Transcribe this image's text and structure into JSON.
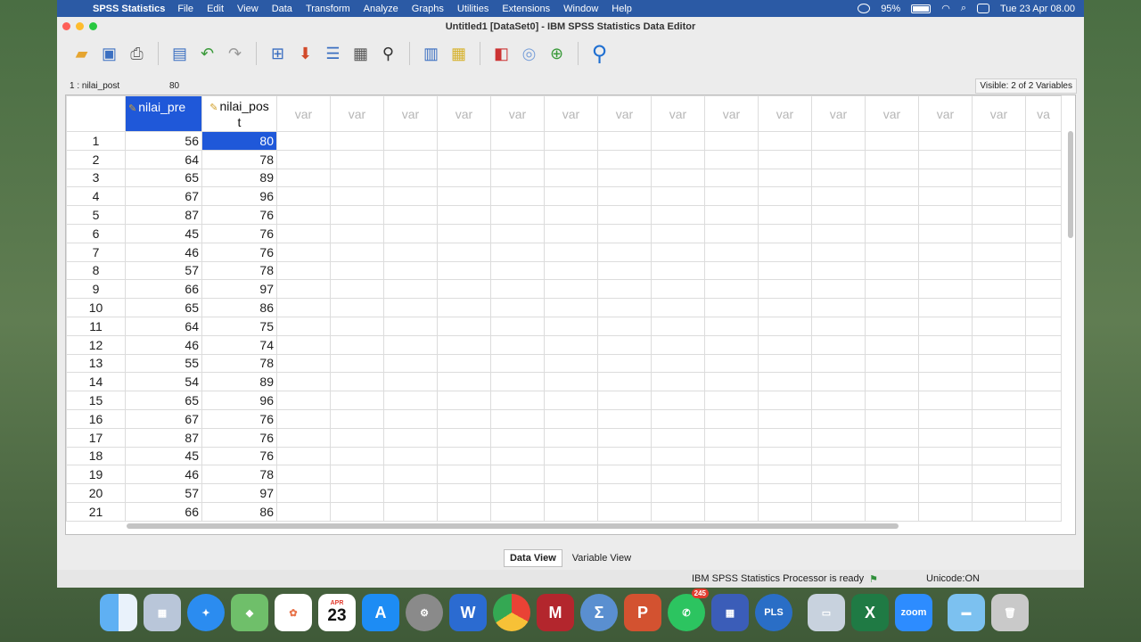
{
  "menubar": {
    "app": "SPSS Statistics",
    "items": [
      "File",
      "Edit",
      "View",
      "Data",
      "Transform",
      "Analyze",
      "Graphs",
      "Utilities",
      "Extensions",
      "Window",
      "Help"
    ],
    "battery": "95%",
    "datetime": "Tue 23 Apr  08.00"
  },
  "window": {
    "title": "Untitled1 [DataSet0] - IBM SPSS Statistics Data Editor"
  },
  "toolbar": {
    "icons": [
      "open-folder-icon",
      "save-icon",
      "print-icon",
      "recall-dialog-icon",
      "undo-icon",
      "redo-icon",
      "goto-case-icon",
      "goto-variable-icon",
      "variables-icon",
      "run-descriptives-icon",
      "find-icon",
      "insert-cases-icon",
      "insert-variable-icon",
      "split-file-icon",
      "weight-cases-icon",
      "select-cases-icon",
      "value-labels-icon",
      "search-icon"
    ]
  },
  "cellbar": {
    "ref": "1 : nilai_post",
    "value": "80",
    "visible": "Visible: 2 of 2 Variables"
  },
  "grid": {
    "columns": [
      "nilai_pre",
      "nilai_pos\nt"
    ],
    "empty_label": "var",
    "last_partial": "va",
    "rows": [
      {
        "n": "1",
        "pre": "56",
        "post": "80"
      },
      {
        "n": "2",
        "pre": "64",
        "post": "78"
      },
      {
        "n": "3",
        "pre": "65",
        "post": "89"
      },
      {
        "n": "4",
        "pre": "67",
        "post": "96"
      },
      {
        "n": "5",
        "pre": "87",
        "post": "76"
      },
      {
        "n": "6",
        "pre": "45",
        "post": "76"
      },
      {
        "n": "7",
        "pre": "46",
        "post": "76"
      },
      {
        "n": "8",
        "pre": "57",
        "post": "78"
      },
      {
        "n": "9",
        "pre": "66",
        "post": "97"
      },
      {
        "n": "10",
        "pre": "65",
        "post": "86"
      },
      {
        "n": "11",
        "pre": "64",
        "post": "75"
      },
      {
        "n": "12",
        "pre": "46",
        "post": "74"
      },
      {
        "n": "13",
        "pre": "55",
        "post": "78"
      },
      {
        "n": "14",
        "pre": "54",
        "post": "89"
      },
      {
        "n": "15",
        "pre": "65",
        "post": "96"
      },
      {
        "n": "16",
        "pre": "67",
        "post": "76"
      },
      {
        "n": "17",
        "pre": "87",
        "post": "76"
      },
      {
        "n": "18",
        "pre": "45",
        "post": "76"
      },
      {
        "n": "19",
        "pre": "46",
        "post": "78"
      },
      {
        "n": "20",
        "pre": "57",
        "post": "97"
      },
      {
        "n": "21",
        "pre": "66",
        "post": "86"
      }
    ]
  },
  "tabs": [
    "Data View",
    "Variable View"
  ],
  "status": {
    "processor": "IBM SPSS Statistics Processor is ready",
    "unicode": "Unicode:ON"
  },
  "dock": {
    "calendar_month": "APR",
    "calendar_day": "23",
    "whatsapp_badge": "245",
    "pls_label": "PLS",
    "zoom_label": "zoom"
  }
}
